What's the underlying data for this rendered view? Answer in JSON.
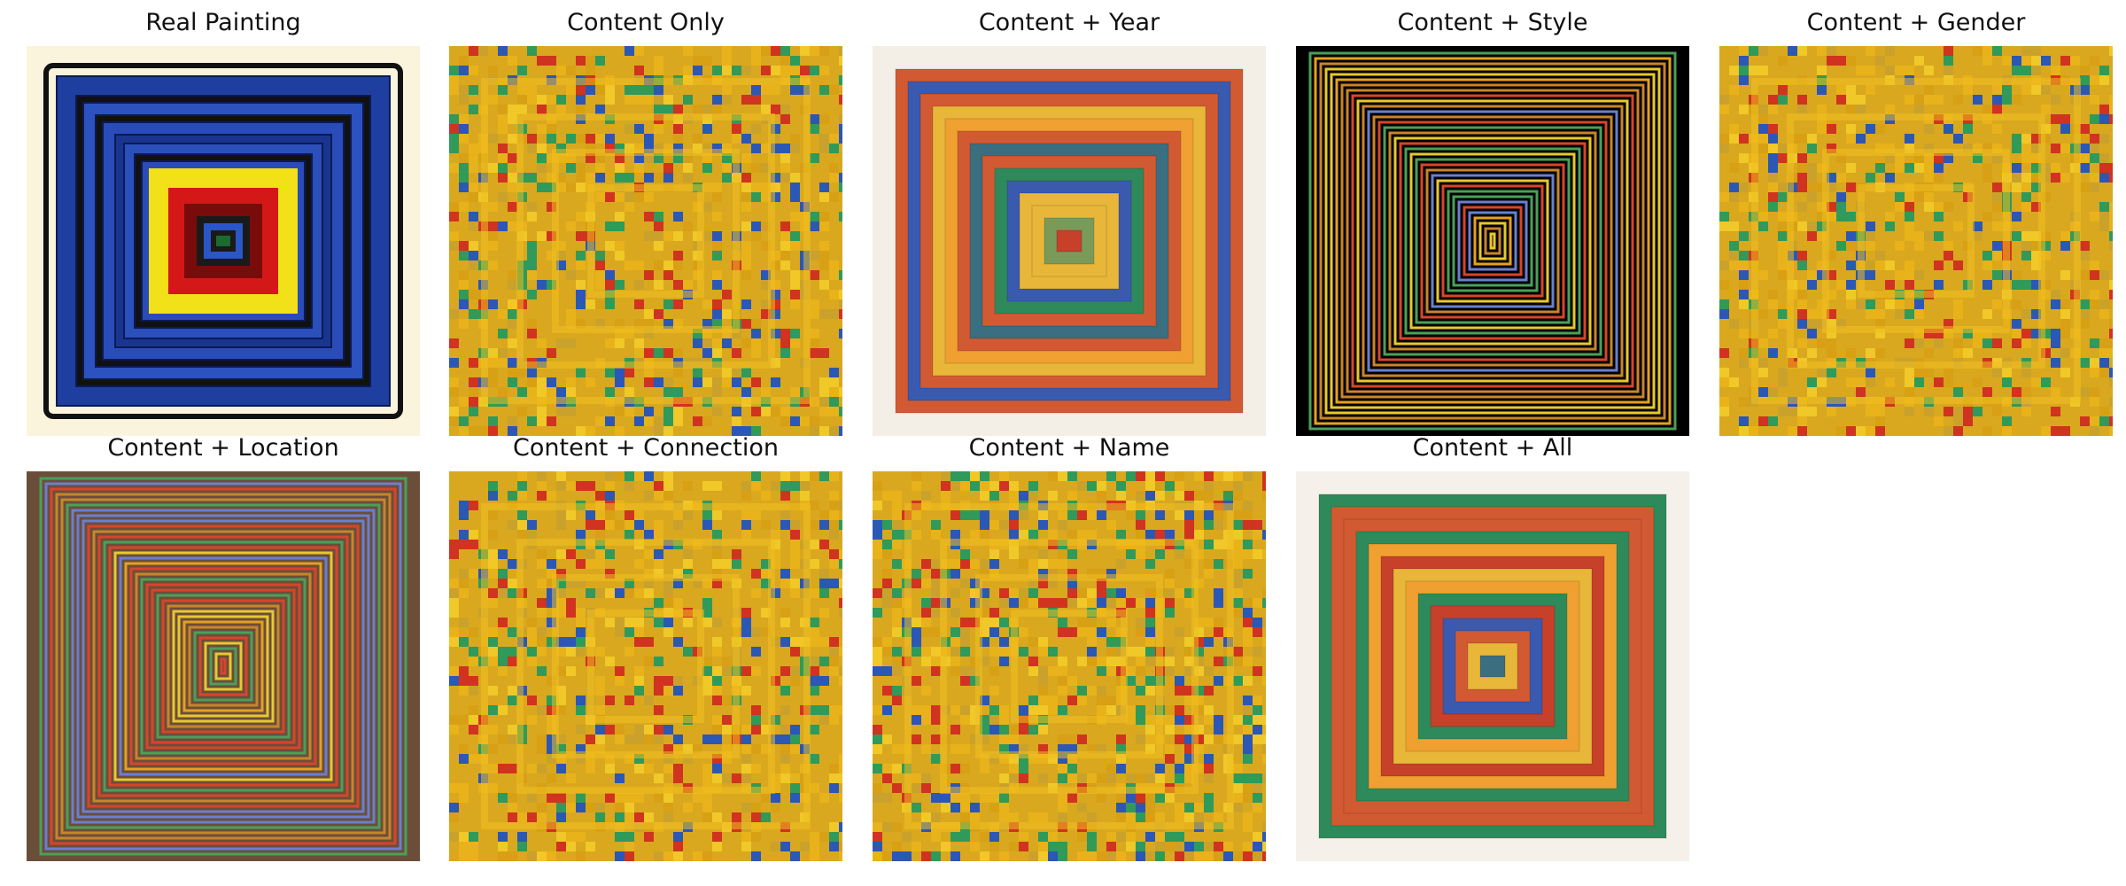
{
  "figure": {
    "panels": [
      {
        "title": "Real Painting",
        "style": "real"
      },
      {
        "title": "Content Only",
        "style": "pixel"
      },
      {
        "title": "Content + Year",
        "style": "soft"
      },
      {
        "title": "Content + Style",
        "style": "lines"
      },
      {
        "title": "Content + Gender",
        "style": "pixel"
      },
      {
        "title": "Content + Location",
        "style": "lines"
      },
      {
        "title": "Content + Connection",
        "style": "pixel"
      },
      {
        "title": "Content + Name",
        "style": "pixel"
      },
      {
        "title": "Content + All",
        "style": "soft"
      }
    ]
  }
}
